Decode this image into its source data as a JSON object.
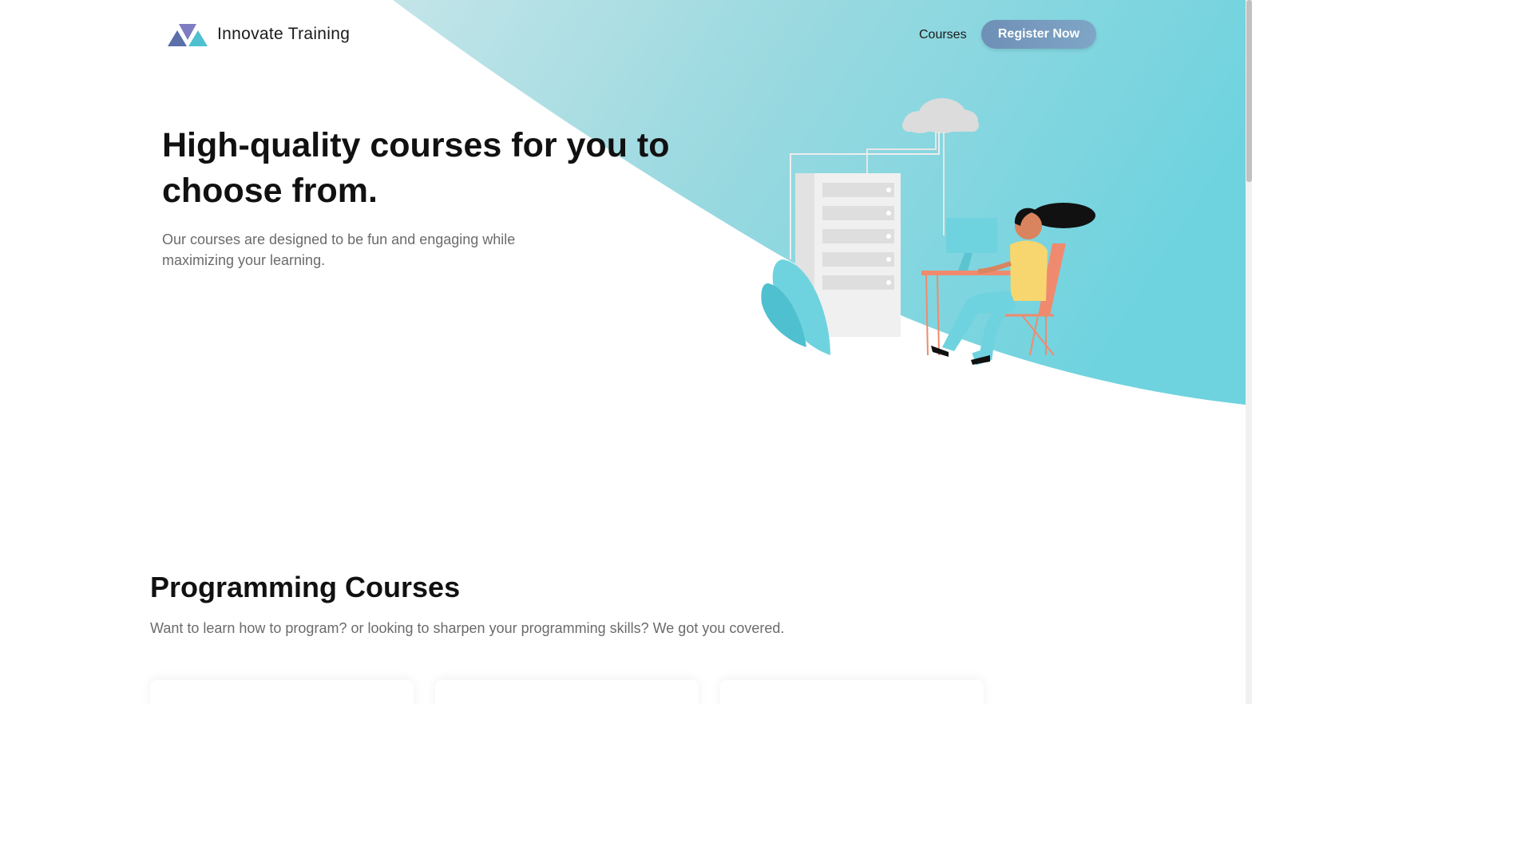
{
  "brand": {
    "name": "Innovate Training"
  },
  "nav": {
    "courses_label": "Courses",
    "register_label": "Register Now"
  },
  "hero": {
    "title": "High-quality courses for you to choose from.",
    "subtitle": "Our courses are designed to be fun and engaging while maximizing your learning."
  },
  "programming": {
    "title": "Programming Courses",
    "subtitle": "Want to learn how to program? or looking to sharpen your programming skills? We got you covered."
  },
  "cards": [
    {
      "id": "card-1"
    },
    {
      "id": "card-2"
    },
    {
      "id": "card-3"
    }
  ],
  "icons": {
    "logo": "mountain-triangles-logo-icon",
    "illustration": "woman-at-desk-cloud-server-illustration"
  },
  "colors": {
    "accent_teal": "#6fd3df",
    "accent_light": "#b9e2e6",
    "button_start": "#6f8fb6",
    "button_end": "#7fa6c6",
    "text_dark": "#111111",
    "text_muted": "#6b6b6b"
  }
}
